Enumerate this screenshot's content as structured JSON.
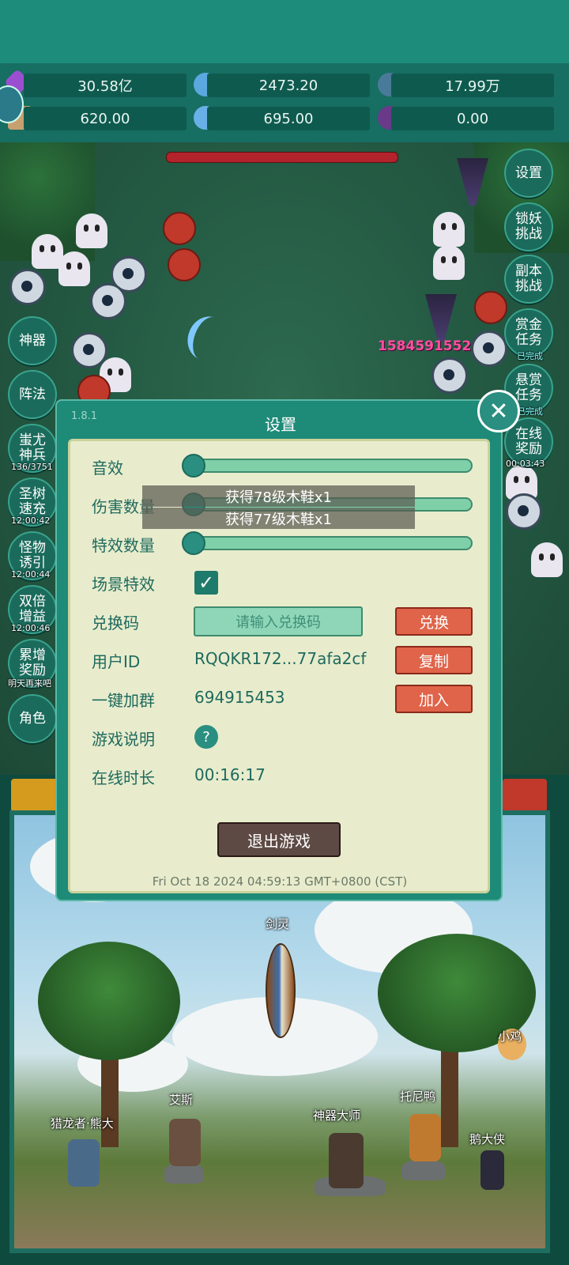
{
  "resources": [
    {
      "icon": "purple-gem-icon",
      "value": "30.58亿"
    },
    {
      "icon": "blue-crystal-icon",
      "value": "2473.20"
    },
    {
      "icon": "planet-icon",
      "value": "17.99万"
    },
    {
      "icon": "scroll-icon",
      "value": "620.00"
    },
    {
      "icon": "ice-crystal-icon",
      "value": "695.00"
    },
    {
      "icon": "purple-orb-icon",
      "value": "0.00"
    }
  ],
  "battle": {
    "damage_number": "1584591552"
  },
  "right_menu": [
    {
      "label": "设置"
    },
    {
      "label": "锁妖\n挑战"
    },
    {
      "label": "副本\n挑战"
    },
    {
      "label": "赏金\n任务",
      "sub": "已完成"
    },
    {
      "label": "悬赏\n任务",
      "sub": "已完成"
    },
    {
      "label": "在线\n奖励",
      "sub": "00:03:43"
    }
  ],
  "left_menu": [
    {
      "label": "神器"
    },
    {
      "label": "阵法"
    },
    {
      "label": "蚩尤\n神兵",
      "sub": "136/3751"
    },
    {
      "label": "圣树\n速充",
      "sub": "12:00:42"
    },
    {
      "label": "怪物\n诱引",
      "sub": "12:00:44"
    },
    {
      "label": "双倍\n增益",
      "sub": "12:00:46"
    },
    {
      "label": "累增\n奖励",
      "sub": "明天再来吧"
    },
    {
      "label": "角色"
    }
  ],
  "dialog": {
    "version": "1.8.1",
    "title": "设置",
    "rows": {
      "sound": "音效",
      "damage_count": "伤害数量",
      "effect_count": "特效数量",
      "scene_effect": "场景特效",
      "redeem": "兑换码",
      "user_id": "用户ID",
      "join_group": "一键加群",
      "game_help": "游戏说明",
      "online_time": "在线时长"
    },
    "redeem_placeholder": "请输入兑换码",
    "redeem_button": "兑换",
    "user_id_value": "RQQKR172...77afa2cf",
    "copy_button": "复制",
    "group_id": "694915453",
    "join_button": "加入",
    "help_symbol": "?",
    "online_time_value": "00:16:17",
    "exit_button": "退出游戏",
    "timestamp": "Fri Oct 18 2024 04:59:13 GMT+0800 (CST)",
    "scene_effect_checked": true,
    "sliders": {
      "sound": 0,
      "damage_count": 0,
      "effect_count": 0
    }
  },
  "toasts": [
    "获得78级木鞋x1",
    "获得77级木鞋x1"
  ],
  "scene_characters": [
    "剑灵",
    "小鸡",
    "艾斯",
    "托尼鸭",
    "猎龙者·熊大",
    "神器大师",
    "鹅大侠"
  ],
  "colors": {
    "accent": "#1e8a78",
    "danger": "#e0644a",
    "panel": "#e8eccc"
  }
}
